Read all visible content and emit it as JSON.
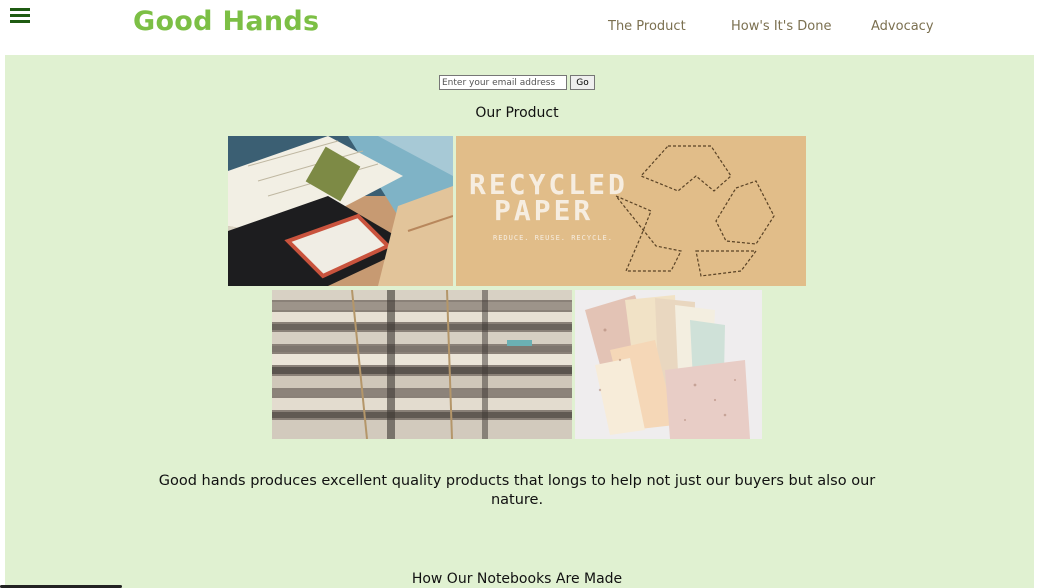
{
  "header": {
    "logo": "Good Hands",
    "nav": [
      "The Product",
      "How's It's Done",
      "Advocacy"
    ],
    "menu_icon": "hamburger-menu-icon"
  },
  "subscribe": {
    "placeholder": "Enter your email address",
    "button_label": "Go"
  },
  "product": {
    "title": "Our Product",
    "images": [
      {
        "name": "notebooks-photo"
      },
      {
        "name": "recycled-paper-banner",
        "text_line1": "RECYCLED",
        "text_line2": "PAPER",
        "tagline": "REDUCE. REUSE. RECYCLE."
      },
      {
        "name": "newspaper-stacks-photo"
      },
      {
        "name": "handmade-paper-photo"
      }
    ],
    "description": "Good hands produces excellent quality products that longs to help not just our buyers but also our nature."
  },
  "process": {
    "title": "How Our Notebooks Are Made"
  },
  "colors": {
    "background": "#e0f1d1",
    "logo": "#7cbf45",
    "nav_text": "#7b7050",
    "menu_icon": "#1f5b12"
  }
}
